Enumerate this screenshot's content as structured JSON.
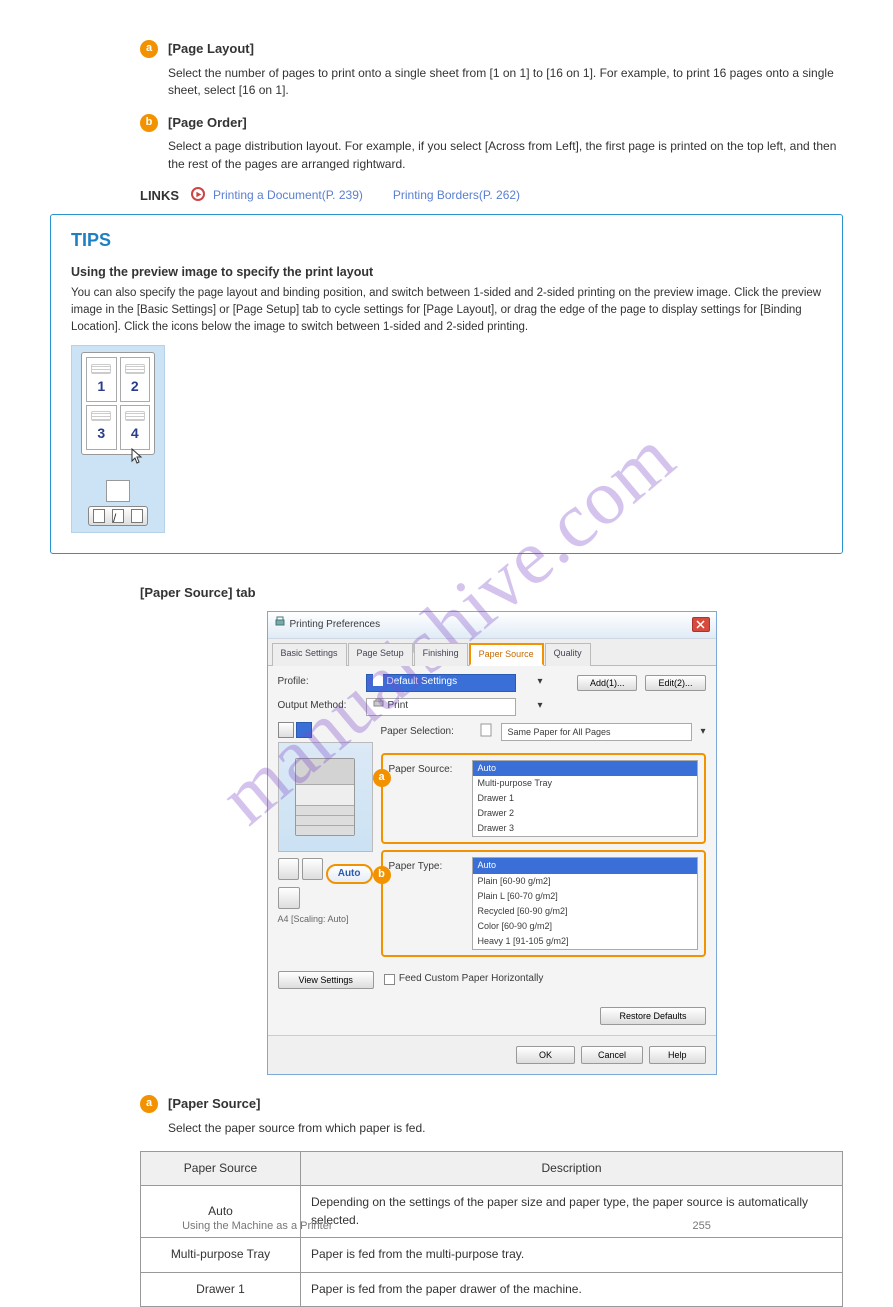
{
  "section_a": {
    "title": "[Page Layout]",
    "text": "Select the number of pages to print onto a single sheet from [1 on 1] to [16 on 1]. For example, to print 16 pages onto a single sheet, select [16 on 1]."
  },
  "section_b": {
    "title": "[Page Order]",
    "text": "Select a page distribution layout. For example, if you select [Across from Left], the first page is printed on the top left, and then the rest of the pages are arranged rightward.",
    "link_label": "LINKS",
    "link_text": "Printing a Document(P. 239)",
    "link_text2": "Printing Borders(P. 262)"
  },
  "tips": {
    "heading": "TIPS",
    "subheading": "Using the preview image to specify the print layout",
    "body": "You can also specify the page layout and binding position, and switch between 1-sided and 2-sided printing on the preview image. Click the preview image in the [Basic Settings] or [Page Setup] tab to cycle settings for [Page Layout], or drag the edge of the page to display settings for [Binding Location]. Click the icons below the image to switch between 1-sided and 2-sided printing.",
    "thumb_numbers": [
      "1",
      "2",
      "3",
      "4"
    ]
  },
  "paper_source_tab": {
    "label": "[Paper Source] tab"
  },
  "dialog": {
    "title": "Printing Preferences",
    "tabs": [
      "Basic Settings",
      "Page Setup",
      "Finishing",
      "Paper Source",
      "Quality"
    ],
    "active_tab": "Paper Source",
    "profile_label": "Profile:",
    "profile_value": "Default Settings",
    "add_btn": "Add(1)...",
    "edit_btn": "Edit(2)...",
    "output_label": "Output Method:",
    "output_value": "Print",
    "paper_selection_label": "Paper Selection:",
    "paper_selection_value": "Same Paper for All Pages",
    "paper_source_label": "Paper Source:",
    "paper_source_items": [
      "Auto",
      "Multi-purpose Tray",
      "Drawer 1",
      "Drawer 2",
      "Drawer 3"
    ],
    "paper_type_label": "Paper Type:",
    "paper_type_items": [
      "Auto",
      "Plain [60-90 g/m2]",
      "Plain L [60-70 g/m2]",
      "Recycled [60-90 g/m2]",
      "Color [60-90 g/m2]",
      "Heavy 1 [91-105 g/m2]"
    ],
    "auto_btn": "Auto",
    "preview_caption": "A4 [Scaling: Auto]",
    "view_settings": "View Settings",
    "feed_checkbox": "Feed Custom Paper Horizontally",
    "restore": "Restore Defaults",
    "ok": "OK",
    "cancel": "Cancel",
    "help": "Help"
  },
  "spec_a": {
    "title": "[Paper Source]",
    "intro": "Select the paper source from which paper is fed.",
    "th_source": "Paper Source",
    "th_desc": "Description",
    "rows": [
      {
        "src": "Auto",
        "desc": "Depending on the settings of the paper size and paper type, the paper source is automatically selected."
      },
      {
        "src": "Multi-purpose Tray",
        "desc": "Paper is fed from the multi-purpose tray."
      },
      {
        "src": "Drawer 1",
        "desc": "Paper is fed from the paper drawer of the machine."
      }
    ]
  },
  "footer": {
    "section": "Using the Machine as a Printer",
    "pageno": "255"
  },
  "watermark": "manualshive.com"
}
